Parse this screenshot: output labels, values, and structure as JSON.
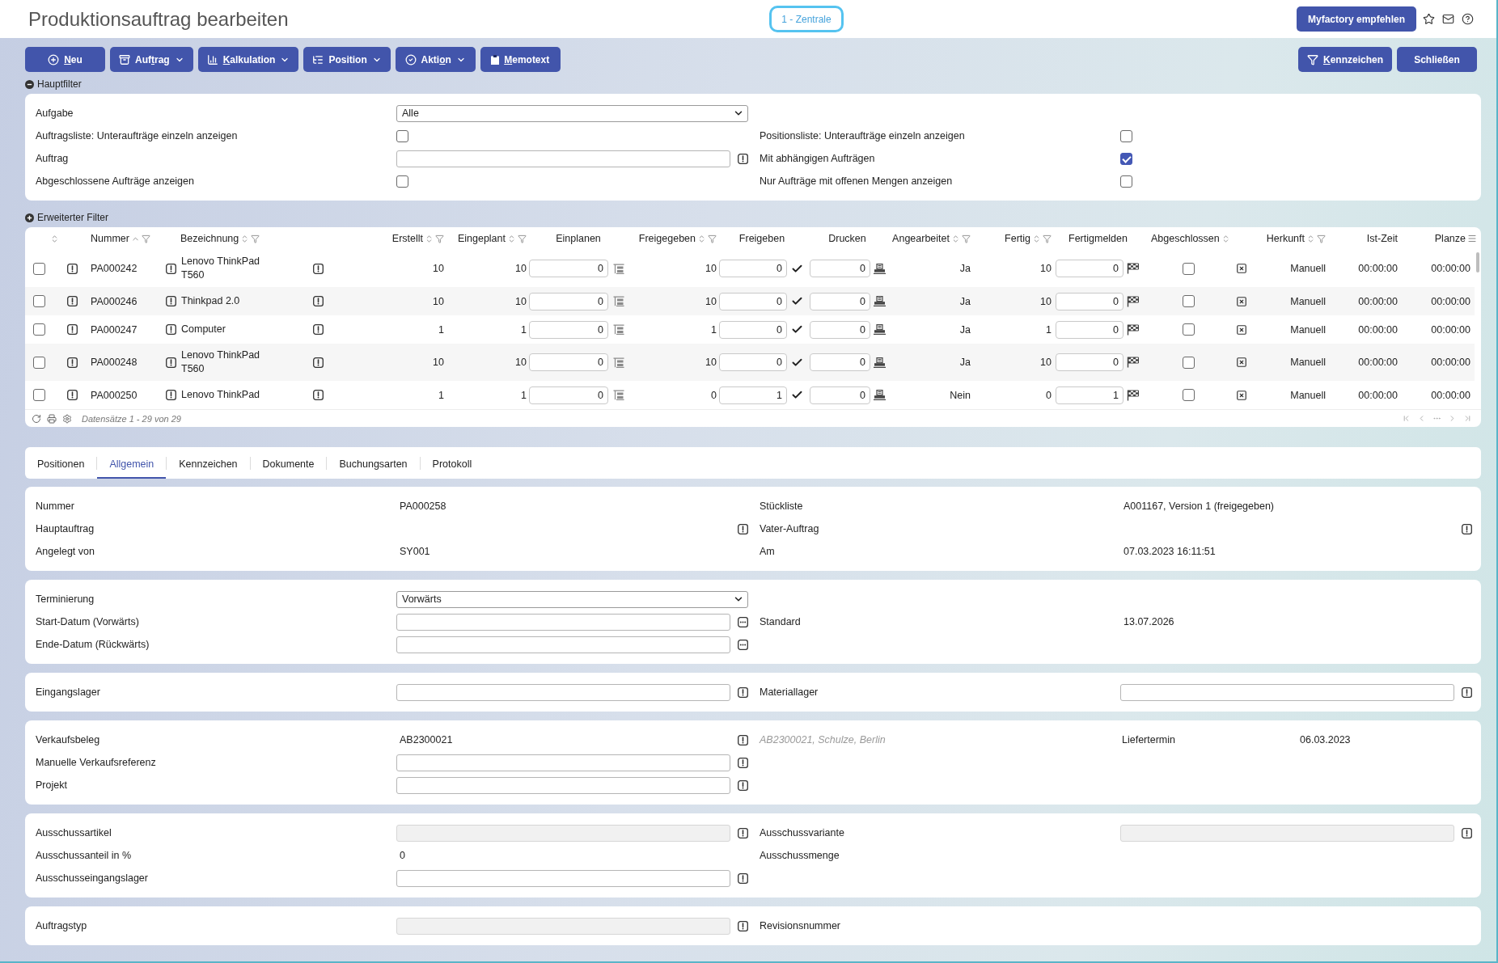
{
  "header": {
    "title": "Produktionsauftrag bearbeiten",
    "company": "1 - Zentrale",
    "recommend_button": "Myfactory empfehlen"
  },
  "toolbar": {
    "left": [
      {
        "kind": "new",
        "menu": false,
        "label": [
          {
            "text": "N",
            "underlined": true
          },
          {
            "text": "eu",
            "underlined": false
          }
        ]
      },
      {
        "kind": "order",
        "menu": true,
        "label": [
          {
            "text": "Auf",
            "underlined": false
          },
          {
            "text": "t",
            "underlined": true
          },
          {
            "text": "rag",
            "underlined": false
          }
        ]
      },
      {
        "kind": "calculation",
        "menu": true,
        "label": [
          {
            "text": "K",
            "underlined": true
          },
          {
            "text": "alkulation",
            "underlined": false
          }
        ]
      },
      {
        "kind": "position",
        "menu": true,
        "label": [
          {
            "text": "Position",
            "underlined": false
          }
        ]
      },
      {
        "kind": "action",
        "menu": true,
        "label": [
          {
            "text": "Akti",
            "underlined": false
          },
          {
            "text": "o",
            "underlined": true
          },
          {
            "text": "n",
            "underlined": false
          }
        ]
      },
      {
        "kind": "memo",
        "menu": false,
        "label": [
          {
            "text": "M",
            "underlined": true
          },
          {
            "text": "emotext",
            "underlined": false
          }
        ]
      }
    ],
    "right": [
      {
        "kind": "flags",
        "menu": false,
        "label": [
          {
            "text": "K",
            "underlined": true
          },
          {
            "text": "ennzeichen",
            "underlined": false
          }
        ]
      },
      {
        "kind": "close",
        "menu": false,
        "label": [
          {
            "text": "Schließen",
            "underlined": false
          }
        ]
      }
    ]
  },
  "main_filter": {
    "title": "Hauptfilter",
    "expanded": true,
    "rows": [
      {
        "left": {
          "label": "Aufgabe",
          "kind": "select",
          "value": "Alle"
        }
      },
      {
        "left": {
          "label": "Auftragsliste: Unteraufträge einzeln anzeigen",
          "kind": "checkbox",
          "checked": false
        },
        "right": {
          "label": "Positionsliste: Unteraufträge einzeln anzeigen",
          "kind": "checkbox",
          "checked": false
        }
      },
      {
        "left": {
          "label": "Auftrag",
          "kind": "input",
          "lookup": true,
          "disabled": false
        },
        "right": {
          "label": "Mit abhängigen Aufträgen",
          "kind": "checkbox",
          "checked": true
        }
      },
      {
        "left": {
          "label": "Abgeschlossene Aufträge anzeigen",
          "kind": "checkbox",
          "checked": false
        },
        "right": {
          "label": "Nur Aufträge mit offenen Mengen anzeigen",
          "kind": "checkbox",
          "checked": false
        }
      }
    ]
  },
  "extended_filter": {
    "title": "Erweiterter Filter",
    "expanded": false
  },
  "table": {
    "columns": [
      {
        "sortable": true,
        "sorted": false
      },
      {
        "label": "Nummer",
        "sortable": true,
        "sorted": true,
        "filter": true
      },
      {
        "label": "Bezeichnung",
        "sortable": true,
        "sorted": false,
        "filter": true
      },
      {
        "label": "Erstellt",
        "sortable": true,
        "sorted": false,
        "filter": true
      },
      {
        "label": "Eingeplant",
        "sortable": true,
        "sorted": false,
        "filter": true
      },
      {
        "label": "Einplanen"
      },
      {
        "label": "Freigegeben",
        "sortable": true,
        "sorted": false,
        "filter": true
      },
      {
        "label": "Freigeben"
      },
      {
        "label": "Drucken"
      },
      {
        "label": "Angearbeitet",
        "sortable": true,
        "sorted": false,
        "filter": true
      },
      {
        "label": "Fertig",
        "sortable": true,
        "sorted": false,
        "filter": true
      },
      {
        "label": "Fertigmelden"
      },
      {
        "label": "Abgeschlossen",
        "sortable": true,
        "sorted": false
      },
      {
        "label": "Herkunft",
        "sortable": true,
        "sorted": false,
        "filter": true
      },
      {
        "label": "Ist-Zeit"
      },
      {
        "label": "Planze"
      }
    ],
    "rows": [
      {
        "selected": false,
        "nummer": "PA000242",
        "bezeichnung": "Lenovo ThinkPad T560",
        "erstellt": "10",
        "eingeplant": "10",
        "einplanen": "0",
        "freigegeben": "10",
        "freigeben": "0",
        "drucken": "0",
        "angearbeitet": "Ja",
        "fertig": "10",
        "fertigmelden": "0",
        "abgeschlossen": false,
        "herkunft": "Manuell",
        "ist_zeit": "00:00:00",
        "column_16": "00:00:00"
      },
      {
        "selected": false,
        "nummer": "PA000246",
        "bezeichnung": "Thinkpad 2.0",
        "erstellt": "10",
        "eingeplant": "10",
        "einplanen": "0",
        "freigegeben": "10",
        "freigeben": "0",
        "drucken": "0",
        "angearbeitet": "Ja",
        "fertig": "10",
        "fertigmelden": "0",
        "abgeschlossen": false,
        "herkunft": "Manuell",
        "ist_zeit": "00:00:00",
        "column_16": "00:00:00"
      },
      {
        "selected": false,
        "nummer": "PA000247",
        "bezeichnung": "Computer",
        "erstellt": "1",
        "eingeplant": "1",
        "einplanen": "0",
        "freigegeben": "1",
        "freigeben": "0",
        "drucken": "0",
        "angearbeitet": "Ja",
        "fertig": "1",
        "fertigmelden": "0",
        "abgeschlossen": false,
        "herkunft": "Manuell",
        "ist_zeit": "00:00:00",
        "column_16": "00:00:00"
      },
      {
        "selected": false,
        "nummer": "PA000248",
        "bezeichnung": "Lenovo ThinkPad T560",
        "erstellt": "10",
        "eingeplant": "10",
        "einplanen": "0",
        "freigegeben": "10",
        "freigeben": "0",
        "drucken": "0",
        "angearbeitet": "Ja",
        "fertig": "10",
        "fertigmelden": "0",
        "abgeschlossen": false,
        "herkunft": "Manuell",
        "ist_zeit": "00:00:00",
        "column_16": "00:00:00"
      },
      {
        "selected": false,
        "nummer": "PA000250",
        "bezeichnung": "Lenovo ThinkPad",
        "erstellt": "1",
        "eingeplant": "1",
        "einplanen": "0",
        "freigegeben": "0",
        "freigeben": "1",
        "drucken": "0",
        "angearbeitet": "Nein",
        "fertig": "0",
        "fertigmelden": "1",
        "abgeschlossen": false,
        "herkunft": "Manuell",
        "ist_zeit": "00:00:00",
        "column_16": "00:00:00"
      }
    ],
    "footer": "Datensätze 1 - 29 von 29"
  },
  "tabs": [
    {
      "label": "Positionen",
      "selected": false
    },
    {
      "label": "Allgemein",
      "selected": true
    },
    {
      "label": "Kennzeichen",
      "selected": false
    },
    {
      "label": "Dokumente",
      "selected": false
    },
    {
      "label": "Buchungsarten",
      "selected": false
    },
    {
      "label": "Protokoll",
      "selected": false
    }
  ],
  "sections": [
    {
      "rows": [
        {
          "left": {
            "label": "Nummer",
            "kind": "value",
            "value": "PA000258"
          },
          "right": {
            "label": "Stückliste",
            "kind": "value",
            "value": "A001167, Version 1 (freigegeben)"
          }
        },
        {
          "left": {
            "label": "Hauptauftrag",
            "kind": "value",
            "lookup": true
          },
          "right": {
            "label": "Vater-Auftrag",
            "kind": "value",
            "lookup": true
          }
        },
        {
          "left": {
            "label": "Angelegt von",
            "kind": "value",
            "value": "SY001"
          },
          "right": {
            "label": "Am",
            "kind": "value",
            "value": "07.03.2023 16:11:51"
          }
        }
      ]
    },
    {
      "rows": [
        {
          "left": {
            "label": "Terminierung",
            "kind": "select",
            "value": "Vorwärts"
          }
        },
        {
          "left": {
            "label": "Start-Datum (Vorwärts)",
            "kind": "date"
          },
          "right": {
            "label": "Standard",
            "kind": "value",
            "value": "13.07.2026"
          }
        },
        {
          "left": {
            "label": "Ende-Datum (Rückwärts)",
            "kind": "date"
          }
        }
      ]
    },
    {
      "rows": [
        {
          "left": {
            "label": "Eingangslager",
            "kind": "input",
            "lookup": true,
            "disabled": false
          },
          "right": {
            "label": "Materiallager",
            "kind": "input",
            "lookup": true,
            "disabled": false
          }
        }
      ]
    },
    {
      "rows": [
        {
          "left": {
            "label": "Verkaufsbeleg",
            "kind": "value",
            "value": "AB2300021",
            "lookup": true
          },
          "right": {
            "kind": "reference",
            "note": "AB2300021, Schulze, Berlin",
            "label": "Liefertermin",
            "value": "06.03.2023"
          }
        },
        {
          "left": {
            "label": "Manuelle Verkaufsreferenz",
            "kind": "input",
            "lookup": true,
            "disabled": false
          }
        },
        {
          "left": {
            "label": "Projekt",
            "kind": "input",
            "lookup": true,
            "disabled": false
          }
        }
      ]
    },
    {
      "rows": [
        {
          "left": {
            "label": "Ausschussartikel",
            "kind": "input",
            "lookup": true,
            "disabled": true
          },
          "right": {
            "label": "Ausschussvariante",
            "kind": "input",
            "lookup": true,
            "disabled": true
          }
        },
        {
          "left": {
            "label": "Ausschussanteil in %",
            "kind": "value",
            "value": "0"
          },
          "right": {
            "label": "Ausschussmenge"
          }
        },
        {
          "left": {
            "label": "Ausschusseingangslager",
            "kind": "input",
            "lookup": true,
            "disabled": false
          }
        }
      ]
    },
    {
      "rows": [
        {
          "left": {
            "label": "Auftragstyp",
            "kind": "input",
            "lookup": true,
            "disabled": true
          },
          "right": {
            "label": "Revisionsnummer"
          }
        }
      ]
    }
  ]
}
